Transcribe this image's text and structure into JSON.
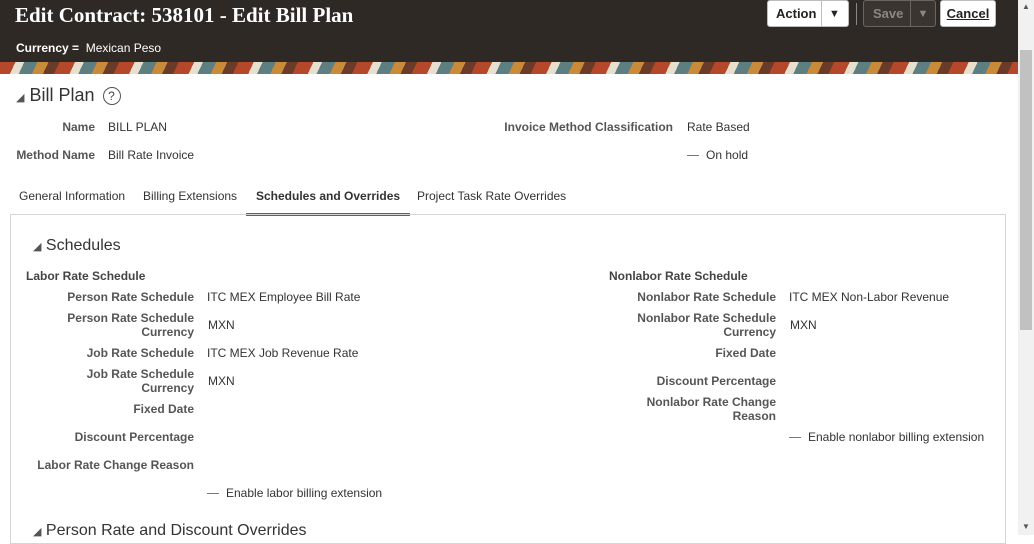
{
  "header": {
    "title": "Edit Contract: 538101 - Edit Bill Plan",
    "currency_label": "Currency =",
    "currency_value": "Mexican Peso",
    "action_label": "Action",
    "save_label": "Save",
    "cancel_label": "Cancel"
  },
  "bill_plan": {
    "title": "Bill Plan",
    "name_label": "Name",
    "name_value": "BILL PLAN",
    "method_label": "Method Name",
    "method_value": "Bill Rate Invoice",
    "invoice_class_label": "Invoice Method Classification",
    "invoice_class_value": "Rate Based",
    "on_hold_label": "On hold"
  },
  "tabs": [
    {
      "label": "General Information"
    },
    {
      "label": "Billing Extensions"
    },
    {
      "label": "Schedules and Overrides"
    },
    {
      "label": "Project Task Rate Overrides"
    }
  ],
  "schedules": {
    "title": "Schedules",
    "labor": {
      "heading": "Labor Rate Schedule",
      "person_rate_label": "Person Rate Schedule",
      "person_rate_value": "ITC MEX Employee Bill Rate",
      "person_currency_label": "Person Rate Schedule Currency",
      "person_currency_value": "MXN",
      "job_rate_label": "Job Rate Schedule",
      "job_rate_value": "ITC MEX Job Revenue Rate",
      "job_currency_label": "Job Rate Schedule Currency",
      "job_currency_value": "MXN",
      "fixed_date_label": "Fixed Date",
      "discount_label": "Discount Percentage",
      "change_reason_label": "Labor Rate Change Reason",
      "extension_label": "Enable labor billing extension"
    },
    "nonlabor": {
      "heading": "Nonlabor Rate Schedule",
      "rate_label": "Nonlabor Rate Schedule",
      "rate_value": "ITC MEX Non-Labor Revenue",
      "currency_label": "Nonlabor Rate Schedule Currency",
      "currency_value": "MXN",
      "fixed_date_label": "Fixed Date",
      "discount_label": "Discount Percentage",
      "change_reason_label": "Nonlabor Rate Change Reason",
      "extension_label": "Enable nonlabor billing extension"
    }
  },
  "overrides": {
    "title": "Person Rate and Discount Overrides"
  },
  "colors": {
    "header_bg": "#2f2926",
    "active_tab": "#3a7d3a"
  }
}
